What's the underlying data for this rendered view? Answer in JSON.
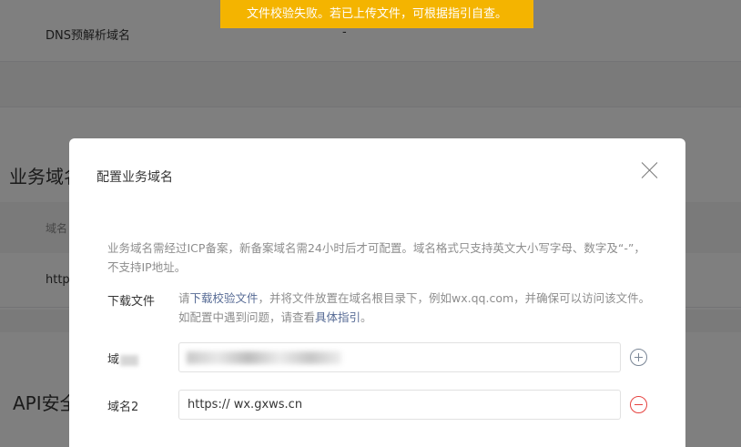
{
  "background": {
    "dns_label": "DNS预解析域名",
    "dns_value": "-",
    "section_heading": "业务域名",
    "table_header_domain": "域名",
    "table_row_value": "http",
    "api_heading": "API安全"
  },
  "toast": {
    "message": "文件校验失败。若已上传文件，可根据指引自查。",
    "color": "#f4b400"
  },
  "dialog": {
    "title": "配置业务域名",
    "description": "业务域名需经过ICP备案，新备案域名需24小时后才可配置。域名格式只支持英文大小写字母、数字及“-”，不支持IP地址。",
    "download": {
      "label": "下载文件",
      "text_prefix": "请",
      "download_link": "下载校验文件",
      "text_middle": "，并将文件放置在域名根目录下，例如wx.qq.com，并确保可以访问该文件。如配置中遇到问题，请查看",
      "guide_link": "具体指引",
      "text_suffix": "。"
    },
    "rows": [
      {
        "label": "域",
        "value": "",
        "action": "plus-icon"
      },
      {
        "label": "域名2",
        "value": "https:// wx.gxws.cn",
        "action": "minus-icon"
      }
    ]
  },
  "colors": {
    "link": "#576b95",
    "danger": "#e64340"
  }
}
